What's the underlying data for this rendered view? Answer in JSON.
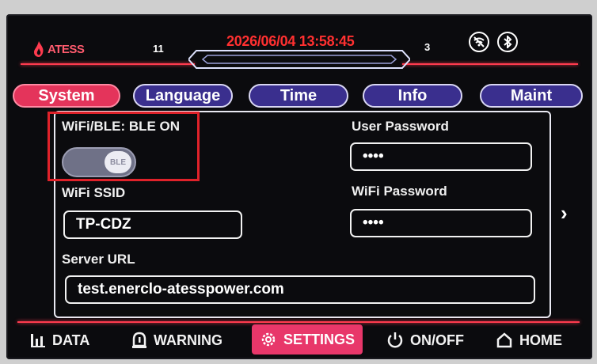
{
  "header": {
    "brand": "ATESS",
    "indicator_left": "11",
    "datetime": "2026/06/04 13:58:45",
    "indicator_right": "3",
    "icons": [
      "wifi-off-icon",
      "bluetooth-icon"
    ],
    "accent_color": "#ff3b4f"
  },
  "tabs": [
    {
      "label": "System",
      "active": true
    },
    {
      "label": "Language",
      "active": false
    },
    {
      "label": "Time",
      "active": false
    },
    {
      "label": "Info",
      "active": false
    },
    {
      "label": "Maint",
      "active": false
    }
  ],
  "system": {
    "wifi_ble_label": "WiFi/BLE: BLE ON",
    "toggle_knob": "BLE",
    "toggle_on": true,
    "user_password_label": "User Password",
    "user_password_value": "••••",
    "wifi_ssid_label": "WiFi SSID",
    "wifi_ssid_value": "TP-CDZ",
    "wifi_password_label": "WiFi Password",
    "wifi_password_value": "••••",
    "server_url_label": "Server URL",
    "server_url_value": "test.enerclo-atesspower.com"
  },
  "bottom_nav": [
    {
      "label": "DATA",
      "icon": "bar-chart-icon",
      "active": false
    },
    {
      "label": "WARNING",
      "icon": "alarm-icon",
      "active": false
    },
    {
      "label": "SETTINGS",
      "icon": "gear-icon",
      "active": true
    },
    {
      "label": "ON/OFF",
      "icon": "power-icon",
      "active": false
    },
    {
      "label": "HOME",
      "icon": "home-icon",
      "active": false
    }
  ]
}
